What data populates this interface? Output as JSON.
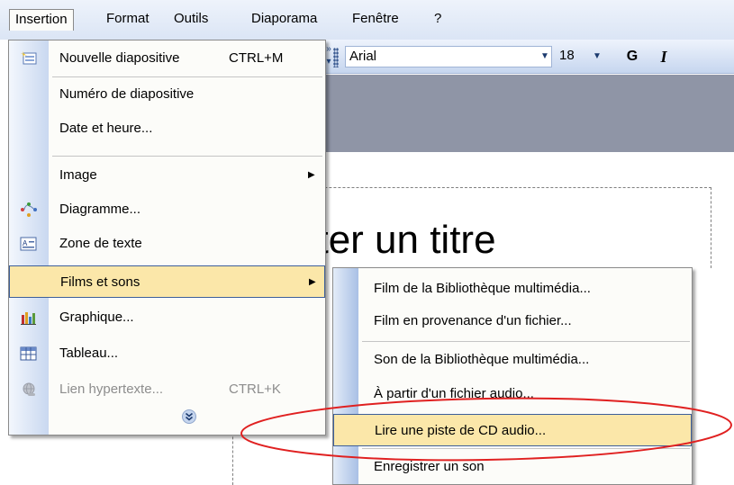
{
  "menubar": {
    "items": [
      {
        "label": "Insertion",
        "active": true
      },
      {
        "label": "Format"
      },
      {
        "label": "Outils"
      },
      {
        "label": "Diaporama"
      },
      {
        "label": "Fenêtre"
      },
      {
        "label": "?"
      }
    ]
  },
  "toolbar": {
    "font_value": "Arial",
    "size_value": "18",
    "bold_label": "G",
    "italic_label": "I"
  },
  "slide": {
    "title_text": "uter un titre"
  },
  "insertion_menu": {
    "items": [
      {
        "label": "Nouvelle diapositive",
        "shortcut": "CTRL+M",
        "icon": "new-slide-icon"
      },
      {
        "label": "Numéro de diapositive"
      },
      {
        "label": "Date et heure..."
      },
      {
        "label": "Image",
        "submenu": true
      },
      {
        "label": "Diagramme...",
        "icon": "diagram-icon"
      },
      {
        "label": "Zone de texte",
        "icon": "text-box-icon"
      },
      {
        "label": "Films et sons",
        "submenu": true,
        "highlighted": true
      },
      {
        "label": "Graphique...",
        "icon": "chart-icon"
      },
      {
        "label": "Tableau...",
        "icon": "table-icon"
      },
      {
        "label": "Lien hypertexte...",
        "shortcut": "CTRL+K",
        "icon": "hyperlink-icon",
        "disabled": true
      }
    ],
    "expand_icon": "chevron-double-down-icon"
  },
  "films_sons_submenu": {
    "items": [
      {
        "label": "Film de la Bibliothèque multimédia..."
      },
      {
        "label": "Film en provenance d'un fichier..."
      },
      {
        "label": "Son de la Bibliothèque multimédia..."
      },
      {
        "label": "À partir d'un fichier audio..."
      },
      {
        "label": "Lire une piste de CD audio...",
        "highlighted": true
      },
      {
        "label": "Enregistrer un son"
      }
    ]
  },
  "colors": {
    "menu_highlight": "#fbe7a9",
    "highlight_border": "#3d5f9a",
    "annotation_ellipse": "#e02020"
  }
}
